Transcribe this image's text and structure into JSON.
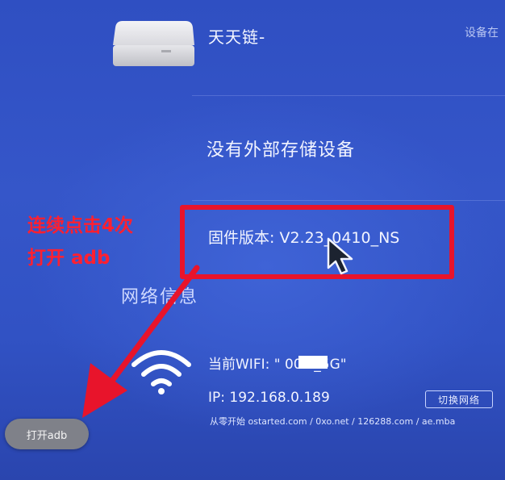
{
  "device": {
    "name": "天天链-",
    "status": "设备在"
  },
  "storage": {
    "message": "没有外部存储设备"
  },
  "firmware": {
    "label": "固件版本: V2.23_0410_NS"
  },
  "annotation": {
    "line1": "连续点击4次",
    "line2": "打开 adb",
    "color": "#e8142b"
  },
  "network": {
    "heading": "网络信息",
    "wifi_label": "当前WIFI: \"        00M_5G\"",
    "ip_label": "IP: 192.168.0.189",
    "switch_button": "切换网络"
  },
  "watermark": "从零开始 ostarted.com / 0xo.net / 126288.com / ae.mba",
  "toast": {
    "text": "打开adb"
  },
  "icons": [
    "device-box-icon",
    "mouse-cursor-icon",
    "wifi-icon",
    "red-arrow-icon"
  ]
}
